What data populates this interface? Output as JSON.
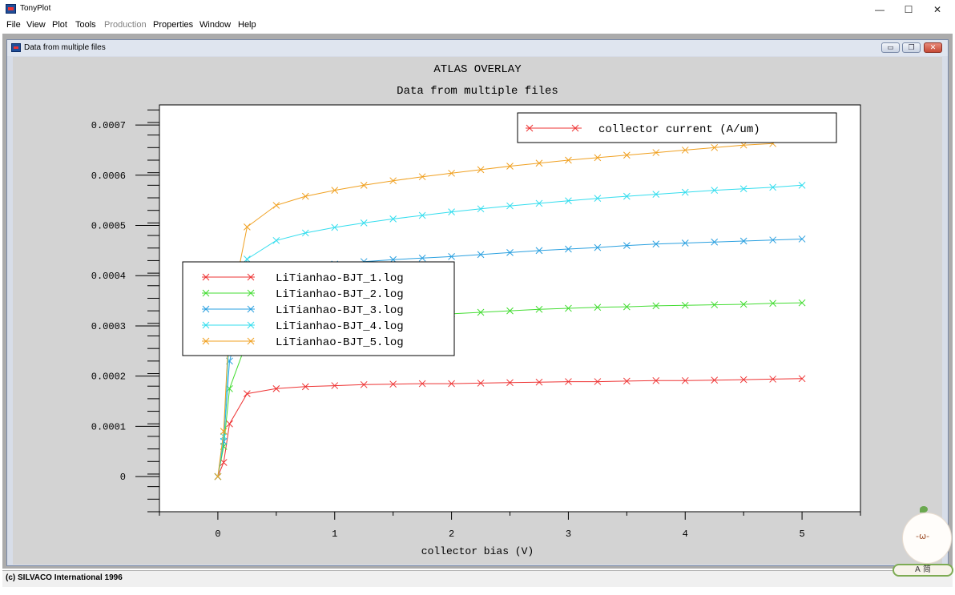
{
  "app": {
    "title": "TonyPlot"
  },
  "window_controls": {
    "minimize": "—",
    "maximize": "☐",
    "close": "✕"
  },
  "menu": {
    "file": "File",
    "view": "View",
    "plot": "Plot",
    "tools": "Tools",
    "production": "Production",
    "properties": "Properties",
    "window": "Window",
    "help": "Help"
  },
  "child_window": {
    "title": "Data from multiple files",
    "min": "▭",
    "restore": "❐",
    "close": "✕"
  },
  "status": {
    "text": "(c) SILVACO International 1996"
  },
  "ime": {
    "text": "A 简"
  },
  "mascot": {
    "face": "-ω-"
  },
  "chart_data": {
    "type": "line",
    "title": "ATLAS OVERLAY",
    "subtitle": "Data from multiple files",
    "xlabel": "collector bias (V)",
    "ylabel": "",
    "xlim": [
      -0.5,
      5.5
    ],
    "ylim": [
      -7e-05,
      0.00074
    ],
    "x_ticks": [
      0,
      1,
      2,
      3,
      4,
      5
    ],
    "y_ticks": [
      {
        "value": 0,
        "label": "0"
      },
      {
        "value": 0.0001,
        "label": "0.0001"
      },
      {
        "value": 0.0002,
        "label": "0.0002"
      },
      {
        "value": 0.0003,
        "label": "0.0003"
      },
      {
        "value": 0.0004,
        "label": "0.0004"
      },
      {
        "value": 0.0005,
        "label": "0.0005"
      },
      {
        "value": 0.0006,
        "label": "0.0006"
      },
      {
        "value": 0.0007,
        "label": "0.0007"
      }
    ],
    "grid": false,
    "quantity_legend": {
      "label": "collector current (A/um)",
      "color": "#ee3333",
      "placement": "top-right"
    },
    "legend_placement": "left",
    "x": [
      0,
      0.05,
      0.1,
      0.25,
      0.5,
      0.75,
      1,
      1.25,
      1.5,
      1.75,
      2,
      2.25,
      2.5,
      2.75,
      3,
      3.25,
      3.5,
      3.75,
      4,
      4.25,
      4.5,
      4.75,
      5
    ],
    "series": [
      {
        "name": "LiTianhao-BJT_1.log",
        "color": "#ee3333",
        "values": [
          0,
          2.8e-05,
          0.000105,
          0.000165,
          0.000175,
          0.000179,
          0.000181,
          0.000183,
          0.000184,
          0.000185,
          0.000185,
          0.000186,
          0.000187,
          0.000188,
          0.000189,
          0.000189,
          0.00019,
          0.000191,
          0.000191,
          0.000192,
          0.000193,
          0.000194,
          0.000195
        ]
      },
      {
        "name": "LiTianhao-BJT_2.log",
        "color": "#44dd33",
        "values": [
          0,
          6e-05,
          0.000175,
          0.00027,
          0.000295,
          0.000305,
          0.00031,
          0.000315,
          0.000318,
          0.000321,
          0.000324,
          0.000327,
          0.00033,
          0.000333,
          0.000335,
          0.000337,
          0.000338,
          0.00034,
          0.000341,
          0.000342,
          0.000343,
          0.000345,
          0.000346
        ]
      },
      {
        "name": "LiTianhao-BJT_3.log",
        "color": "#2aa0e0",
        "values": [
          0,
          7e-05,
          0.00023,
          0.00036,
          0.0004,
          0.000415,
          0.000423,
          0.000428,
          0.000432,
          0.000435,
          0.000438,
          0.000442,
          0.000446,
          0.00045,
          0.000453,
          0.000456,
          0.00046,
          0.000463,
          0.000465,
          0.000467,
          0.000469,
          0.000471,
          0.000473
        ]
      },
      {
        "name": "LiTianhao-BJT_4.log",
        "color": "#33ddee",
        "values": [
          0,
          8e-05,
          0.00028,
          0.000433,
          0.00047,
          0.000485,
          0.000496,
          0.000505,
          0.000513,
          0.00052,
          0.000527,
          0.000533,
          0.000539,
          0.000544,
          0.000549,
          0.000554,
          0.000558,
          0.000562,
          0.000566,
          0.00057,
          0.000573,
          0.000576,
          0.00058
        ]
      },
      {
        "name": "LiTianhao-BJT_5.log",
        "color": "#f0a020",
        "values": [
          0,
          9e-05,
          0.00032,
          0.000497,
          0.00054,
          0.000558,
          0.00057,
          0.00058,
          0.000589,
          0.000597,
          0.000604,
          0.000611,
          0.000618,
          0.000624,
          0.00063,
          0.000635,
          0.00064,
          0.000645,
          0.00065,
          0.000655,
          0.00066,
          0.000663,
          null
        ]
      }
    ]
  }
}
